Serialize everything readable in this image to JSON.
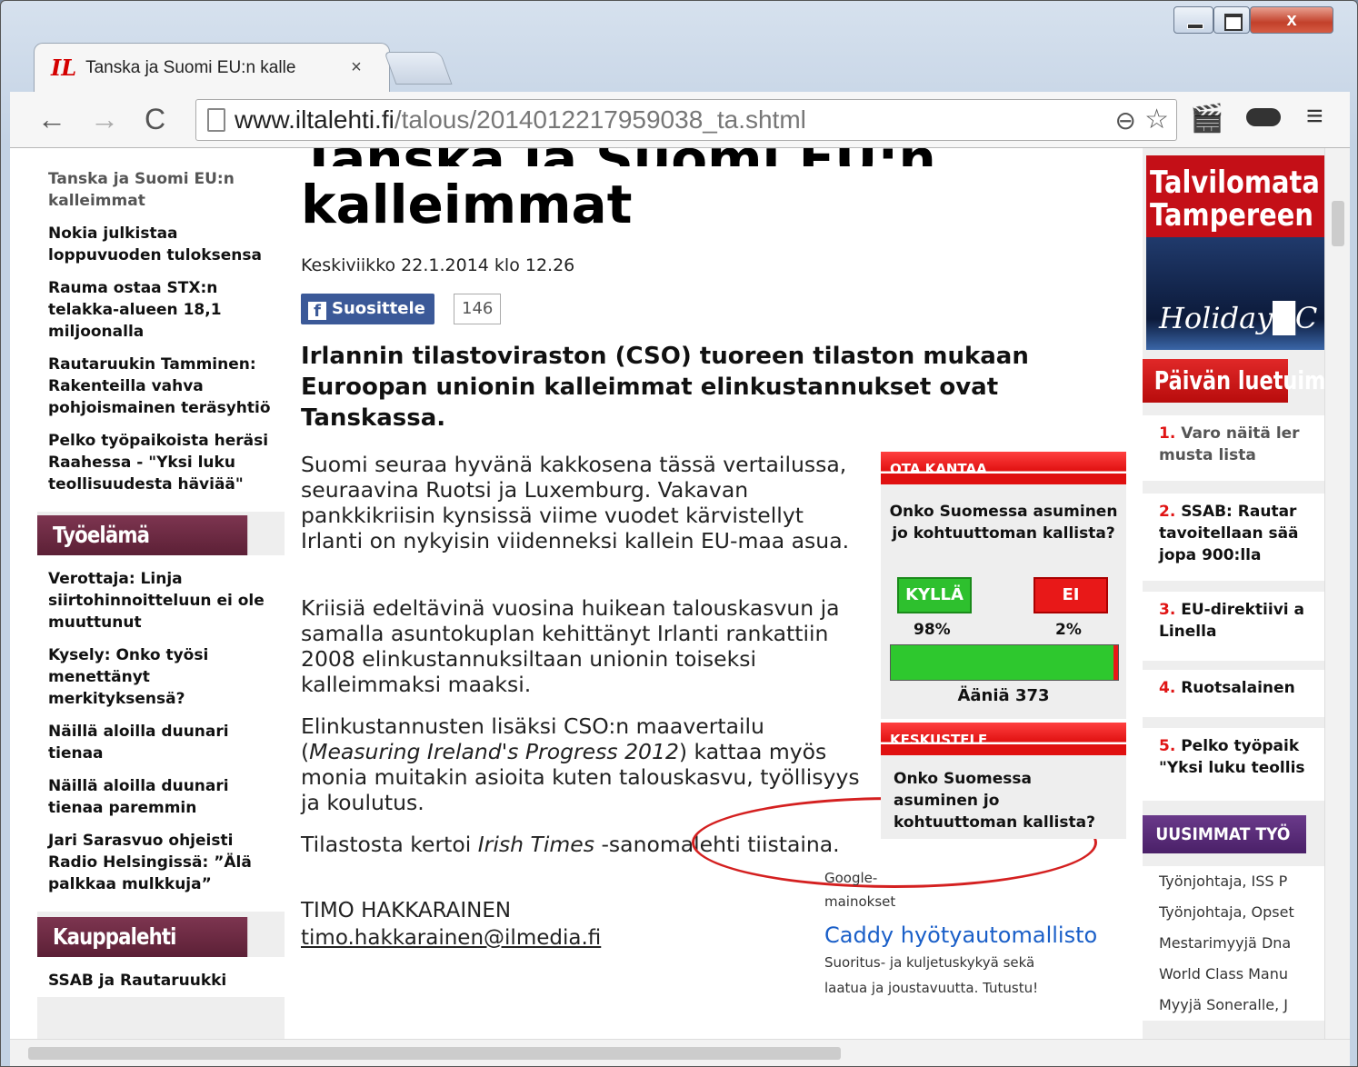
{
  "window": {
    "close_label": "x"
  },
  "tab": {
    "logo": "IL",
    "title": "Tanska ja Suomi EU:n kalle",
    "close": "×"
  },
  "toolbar": {
    "back": "←",
    "forward": "→",
    "reload": "C",
    "url_host": "www.iltalehti.fi",
    "url_path": "/talous/2014012217959038_ta.shtml",
    "zoom": "⊖",
    "star": "☆",
    "menu": "≡"
  },
  "left": {
    "items_top": [
      "Tanska ja Suomi EU:n kalleimmat",
      "Nokia julkistaa loppuvuoden tuloksensa",
      "Rauma ostaa STX:n telakka-alueen 18,1 miljoonalla",
      "Rautaruukin Tamminen: Rakenteilla vahva pohjoismainen teräsyhtiö",
      "Pelko työpaikoista heräsi Raahessa - \"Yksi luku teollisuudesta häviää\""
    ],
    "section1": "Työelämä",
    "items_mid": [
      "Verottaja: Linja siirtohinnoitteluun ei ole muuttunut",
      "Kysely: Onko työsi menettänyt merkityksensä?",
      "Näillä aloilla duunari tienaa",
      "Näillä aloilla duunari tienaa paremmin",
      "Jari Sarasvuo ohjeisti Radio Helsingissä: ”Älä palkkaa mulkkuja”"
    ],
    "section2": "Kauppalehti",
    "items_bottom": [
      "SSAB ja Rautaruukki"
    ]
  },
  "article": {
    "title_cut": "Tanska ja Suomi EU:n",
    "title": "kalleimmat",
    "date": "Keskiviikko 22.1.2014 klo 12.26",
    "fb_label": "Suosittele",
    "fb_icon": "f",
    "fb_count": "146",
    "lead": "Irlannin tilastoviraston (CSO) tuoreen tilaston mukaan Euroopan unionin kalleimmat elinkustannukset ovat Tanskassa.",
    "p1": "Suomi seuraa hyvänä kakkosena tässä vertailussa, seuraavina Ruotsi ja Luxemburg. Vakavan pankkikriisin kynsissä viime vuodet kärvistellyt Irlanti on nykyisin viidenneksi kallein EU-maa asua.",
    "p2": "Kriisiä edeltävinä vuosina huikean talouskasvun ja samalla asuntokuplan kehittänyt Irlanti rankattiin 2008 elinkustannuksiltaan unionin toiseksi kalleimmaksi maaksi.",
    "p3_a": "Elinkustannusten lisäksi CSO:n maavertailu (",
    "p3_em": "Measuring Ireland's Progress 2012",
    "p3_b": ") kattaa myös monia muitakin asioita kuten talouskasvu, työllisyys ja koulutus.",
    "p4_a": "Tilastosta kertoi ",
    "p4_em": "Irish Times",
    "p4_b": " -sanomalehti tiistaina.",
    "author": "TIMO HAKKARAINEN",
    "email": "timo.hakkarainen@ilmedia.fi"
  },
  "poll": {
    "header": "OTA KANTAA",
    "question": "Onko Suomessa asuminen jo kohtuuttoman kallista?",
    "yes_label": "KYLLÄ",
    "no_label": "EI",
    "yes_pct": "98%",
    "no_pct": "2%",
    "yes_share": 98,
    "votes": "Ääniä 373",
    "yes_color": "#2ec82e",
    "no_color": "#e81818"
  },
  "discuss": {
    "header": "KESKUSTELE",
    "question": "Onko Suomessa asuminen jo kohtuuttoman kallista?"
  },
  "ads": {
    "label": "Google-mainokset",
    "title": "Caddy hyötyautomallisto",
    "text": "Suoritus- ja kuljetuskykyä sekä laatua ja joustavuutta. Tutustu!"
  },
  "right": {
    "banner_line1": "Talvilomata",
    "banner_line2": "Tampereen",
    "banner_line3": "Holiday█C",
    "reads_header": "Päivän luetuimma",
    "reads": [
      {
        "num": "1.",
        "text": "Varo näitä ler",
        "text2": "musta lista"
      },
      {
        "num": "2.",
        "text": "SSAB: Rautar",
        "text2": "tavoitellaan sää",
        "text3": "jopa 900:lla"
      },
      {
        "num": "3.",
        "text": "EU-direktiivi a",
        "text2": "Linella"
      },
      {
        "num": "4.",
        "text": "Ruotsalainen"
      },
      {
        "num": "5.",
        "text": "Pelko työpaik",
        "text2": "\"Yksi luku teollis"
      }
    ],
    "jobs_header": "UUSIMMAT TYÖ",
    "jobs": [
      "Työnjohtaja, ISS P",
      "Työnjohtaja, Opset",
      "Mestarimyyjä Dna",
      "World Class Manu",
      "Myyjä Soneralle, J"
    ]
  }
}
